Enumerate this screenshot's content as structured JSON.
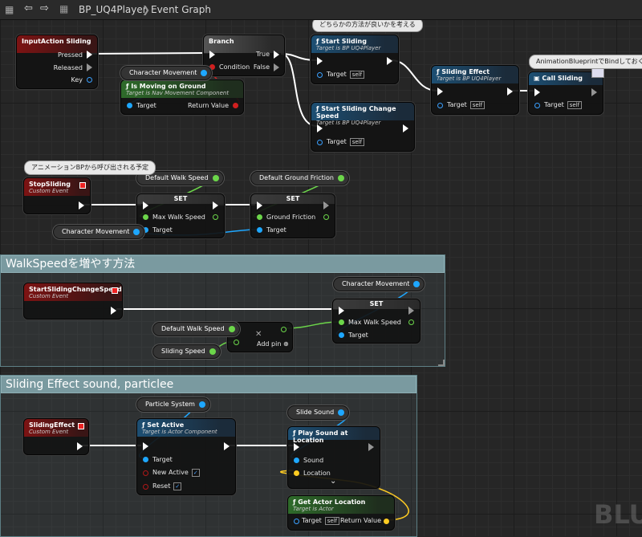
{
  "toolbar": {
    "back_label": "⇦",
    "forward_label": "⇨",
    "grid_label": "▦",
    "blueprint_name": "BP_UQ4Player",
    "separator": "❯",
    "graph_name": "Event Graph"
  },
  "colors": {
    "exec": "#ffffff",
    "object": "#1ea7ff",
    "bool": "#d01f1f",
    "float": "#6cd64a",
    "vector": "#ffcc22",
    "comment": "#7a9aa0",
    "event": "#7d1313"
  },
  "nodes": {
    "input_sliding": {
      "title": "InputAction Sliding",
      "pressed": "Pressed",
      "released": "Released",
      "key": "Key"
    },
    "branch": {
      "title": "Branch",
      "condition": "Condition",
      "true": "True",
      "false": "False"
    },
    "char_movement_1": {
      "label": "Character Movement"
    },
    "is_moving": {
      "title": "Is Moving on Ground",
      "subtitle": "Target is Nav Movement Component",
      "target": "Target",
      "return_value": "Return Value"
    },
    "start_sliding": {
      "title": "Start Sliding",
      "subtitle": "Target is BP UQ4Player",
      "target": "Target",
      "self": "self"
    },
    "start_sliding_change": {
      "title": "Start Sliding Change Speed",
      "subtitle": "Target is BP UQ4Player",
      "target": "Target",
      "self": "self"
    },
    "sliding_effect_call": {
      "title": "Sliding Effect",
      "subtitle": "Target is BP UQ4Player",
      "target": "Target",
      "self": "self"
    },
    "call_sliding": {
      "title": "Call Sliding",
      "target": "Target",
      "self": "self"
    },
    "stop_sliding": {
      "title": "StopSliding",
      "subtitle": "Custom Event"
    },
    "default_walk_speed_1": {
      "label": "Default Walk Speed"
    },
    "default_ground_friction": {
      "label": "Default Ground Friction"
    },
    "set_walk": {
      "title": "SET",
      "max_walk": "Max Walk Speed",
      "target": "Target"
    },
    "set_friction": {
      "title": "SET",
      "ground_friction": "Ground Friction",
      "target": "Target"
    },
    "char_movement_2": {
      "label": "Character Movement"
    },
    "start_sliding_change_event": {
      "title": "StartSlidingChangeSpeed",
      "subtitle": "Custom Event"
    },
    "char_movement_3": {
      "label": "Character Movement"
    },
    "set_walk_2": {
      "title": "SET",
      "max_walk": "Max Walk Speed",
      "target": "Target"
    },
    "default_walk_speed_2": {
      "label": "Default Walk Speed"
    },
    "sliding_speed": {
      "label": "Sliding Speed"
    },
    "add_node": {
      "symbol": "✕",
      "add_pin": "Add pin",
      "plus": "⊕"
    },
    "sliding_effect_event": {
      "title": "SlidingEffect",
      "subtitle": "Custom Event"
    },
    "particle_system": {
      "label": "Particle System"
    },
    "set_active": {
      "title": "Set Active",
      "subtitle": "Target is Actor Component",
      "target": "Target",
      "new_active": "New Active",
      "reset": "Reset",
      "check": "✓"
    },
    "slide_sound": {
      "label": "Slide Sound"
    },
    "play_sound": {
      "title": "Play Sound at Location",
      "sound": "Sound",
      "location": "Location",
      "expand": "⌄"
    },
    "get_actor_location": {
      "title": "Get Actor Location",
      "subtitle": "Target is Actor",
      "target": "Target",
      "self": "self",
      "return_value": "Return Value"
    }
  },
  "comments": {
    "bubble_1": "どちらかの方法が良いかを考える",
    "bubble_2": "AnimationBlueprintでBindしておく",
    "bubble_3": "アニメーションBPから呼び出される予定",
    "box_1": "WalkSpeedを増やす方法",
    "box_2": "Sliding Effect sound, particlee"
  },
  "watermark": "BLU"
}
